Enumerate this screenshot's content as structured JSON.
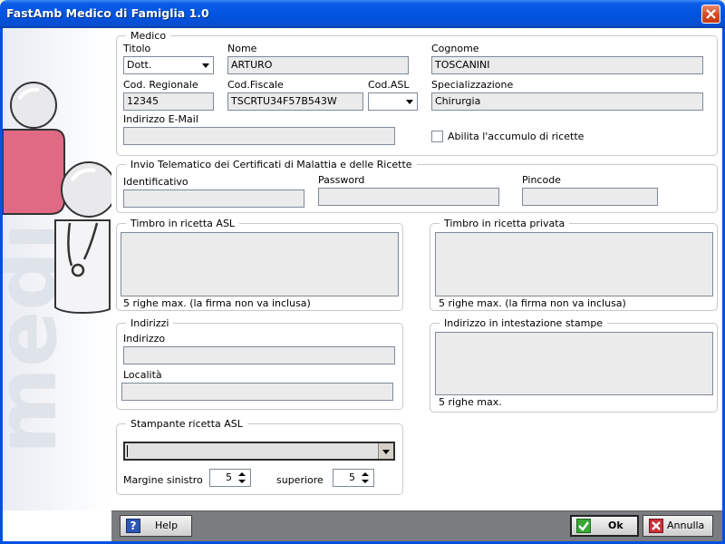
{
  "window": {
    "title": "FastAmb Medico di Famiglia 1.0"
  },
  "sidebar": {
    "watermark": "medi"
  },
  "medico": {
    "legend": "Medico",
    "titolo_label": "Titolo",
    "titolo_value": "Dott.",
    "nome_label": "Nome",
    "nome_value": "ARTURO",
    "cognome_label": "Cognome",
    "cognome_value": "TOSCANINI",
    "cod_regionale_label": "Cod. Regionale",
    "cod_regionale_value": "12345",
    "cod_fiscale_label": "Cod.Fiscale",
    "cod_fiscale_value": "TSCRTU34F57B543W",
    "cod_asl_label": "Cod.ASL",
    "cod_asl_value": "",
    "specializzazione_label": "Specializzazione",
    "specializzazione_value": "Chirurgia",
    "email_label": "Indirizzo E-Mail",
    "email_value": "",
    "accumulo_label": "Abilita l'accumulo di ricette",
    "accumulo_checked": false
  },
  "telematico": {
    "legend": "Invio Telematico dei Certificati di Malattia e delle Ricette",
    "identificativo_label": "Identificativo",
    "identificativo_value": "",
    "password_label": "Password",
    "password_value": "",
    "pincode_label": "Pincode",
    "pincode_value": ""
  },
  "timbro_asl": {
    "legend": "Timbro in ricetta ASL",
    "value": "",
    "note": "5 righe max. (la firma non va inclusa)"
  },
  "timbro_privata": {
    "legend": "Timbro in ricetta privata",
    "value": "",
    "note": "5 righe max. (la firma non va inclusa)"
  },
  "indirizzi": {
    "legend": "Indirizzi",
    "indirizzo_label": "Indirizzo",
    "indirizzo_value": "",
    "localita_label": "Località",
    "localita_value": ""
  },
  "intestazione": {
    "legend": "Indirizzo in intestazione stampe",
    "value": "",
    "note": "5 righe max."
  },
  "stampante": {
    "legend": "Stampante ricetta ASL",
    "printer_value": "",
    "margine_sinistro_label": "Margine sinistro",
    "margine_sinistro_value": "5",
    "superiore_label": "superiore",
    "superiore_value": "5"
  },
  "buttons": {
    "help": "Help",
    "ok": "Ok",
    "annulla": "Annulla"
  },
  "colors": {
    "title_bar": "#0053e1",
    "close_button": "#d6481f",
    "bottom_bar": "#7a7c7f",
    "field_bg": "#ebebeb"
  }
}
